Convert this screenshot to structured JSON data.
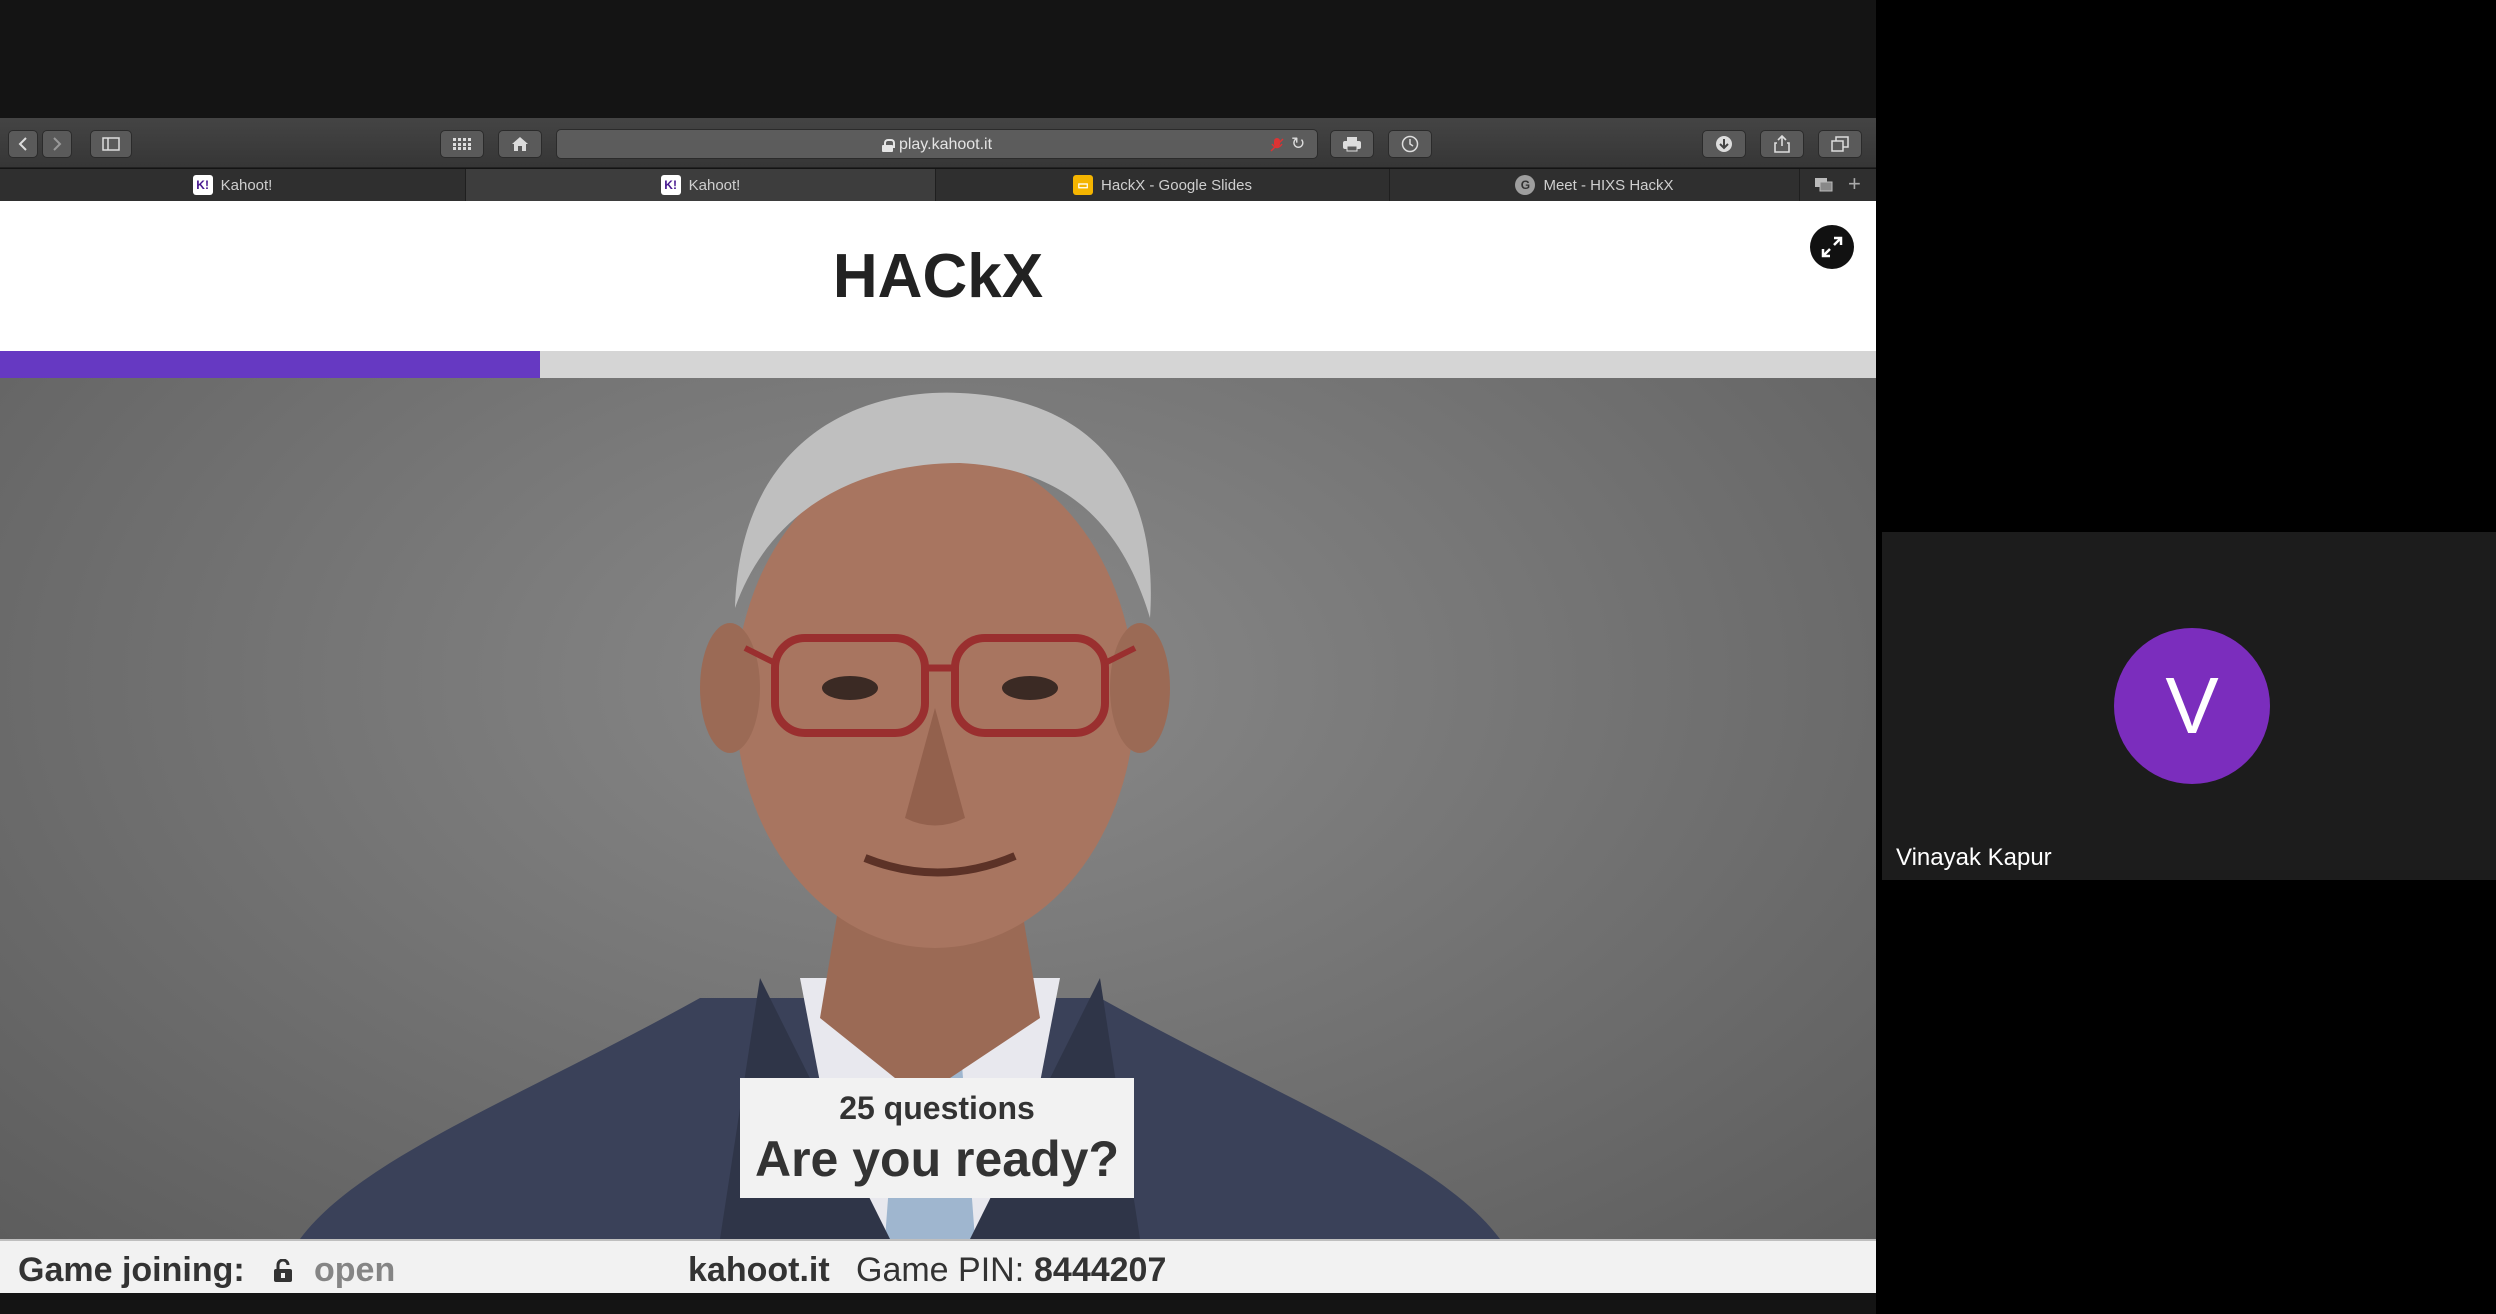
{
  "browser": {
    "url": "play.kahoot.it",
    "tabs": [
      {
        "title": "Kahoot!",
        "favicon": "kahoot-icon",
        "active": false
      },
      {
        "title": "Kahoot!",
        "favicon": "kahoot-icon",
        "active": true
      },
      {
        "title": "HackX - Google Slides",
        "favicon": "slides-icon",
        "active": false
      },
      {
        "title": "Meet - HIXS HackX",
        "favicon": "meet-icon",
        "active": false
      }
    ]
  },
  "kahoot": {
    "quiz_title": "HACkX",
    "progress_fraction": 0.288,
    "question_count": "25 questions",
    "ready_prompt": "Are you ready?",
    "footer": {
      "join_label": "Game joining:",
      "join_status": "open",
      "site": "kahoot.it",
      "pin_label": "Game PIN:",
      "pin_value": "8444207"
    },
    "accent_color": "#6639c2"
  },
  "participant": {
    "initial": "V",
    "name": "Vinayak Kapur",
    "avatar_color": "#7b2dbd"
  }
}
